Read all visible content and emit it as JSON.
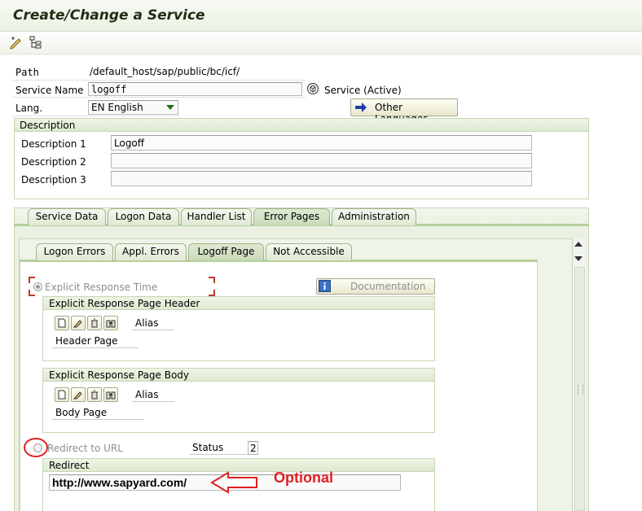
{
  "window": {
    "title": "Create/Change a Service"
  },
  "toolbar": {
    "icons": [
      "edit-pencil-icon",
      "hierarchy-tree-icon"
    ]
  },
  "header": {
    "path_label": "Path",
    "path_value": "/default_host/sap/public/bc/icf/",
    "service_label": "Service Name",
    "service_value": "logoff",
    "service_status": "Service (Active)",
    "lang_label": "Lang.",
    "lang_value": "EN English",
    "other_languages_label": "Other Languages"
  },
  "description": {
    "title": "Description",
    "rows": [
      {
        "label": "Description 1",
        "value": "Logoff"
      },
      {
        "label": "Description 2",
        "value": ""
      },
      {
        "label": "Description 3",
        "value": ""
      }
    ]
  },
  "tabs": [
    "Service Data",
    "Logon Data",
    "Handler List",
    "Error Pages",
    "Administration"
  ],
  "active_tab": "Error Pages",
  "subtabs": [
    "Logon Errors",
    "Appl. Errors",
    "Logoff Page",
    "Not Accessible"
  ],
  "active_subtab": "Logoff Page",
  "logoff": {
    "explicit_label": "Explicit Response Time",
    "documentation_label": "Documentation",
    "header_group": {
      "title": "Explicit Response Page Header",
      "alias_label": "Alias",
      "page_label": "Header Page"
    },
    "body_group": {
      "title": "Explicit Response Page Body",
      "alias_label": "Alias",
      "page_label": "Body Page"
    },
    "redirect_label": "Redirect to URL",
    "status_label": "Status",
    "status_value": "2",
    "redirect_group_title": "Redirect",
    "redirect_url": "http://www.sapyard.com/",
    "annotation": "Optional"
  },
  "colors": {
    "accent_green": "#c7d6b6",
    "annotation_red": "#e02020",
    "title_text": "#1f2d14"
  }
}
